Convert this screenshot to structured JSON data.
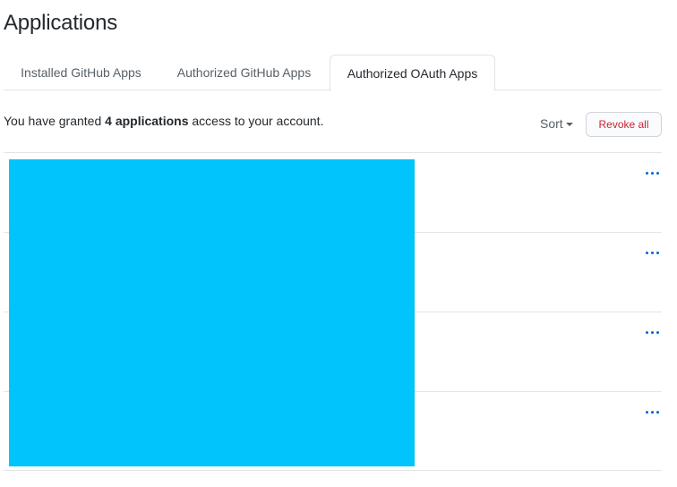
{
  "page": {
    "title": "Applications"
  },
  "tabs": [
    {
      "label": "Installed GitHub Apps",
      "selected": false
    },
    {
      "label": "Authorized GitHub Apps",
      "selected": false
    },
    {
      "label": "Authorized OAuth Apps",
      "selected": true
    }
  ],
  "summary": {
    "prefix": "You have granted ",
    "count_text": "4 applications",
    "suffix": " access to your account."
  },
  "toolbar": {
    "sort_label": "Sort",
    "revoke_all_label": "Revoke all"
  },
  "apps": [
    {
      "menu_icon": "kebab-horizontal-icon"
    },
    {
      "menu_icon": "kebab-horizontal-icon"
    },
    {
      "menu_icon": "kebab-horizontal-icon"
    },
    {
      "menu_icon": "kebab-horizontal-icon"
    }
  ],
  "colors": {
    "link": "#0366d6",
    "danger": "#cb2431",
    "redaction": "#00c4fb",
    "border": "#e1e4e8"
  }
}
